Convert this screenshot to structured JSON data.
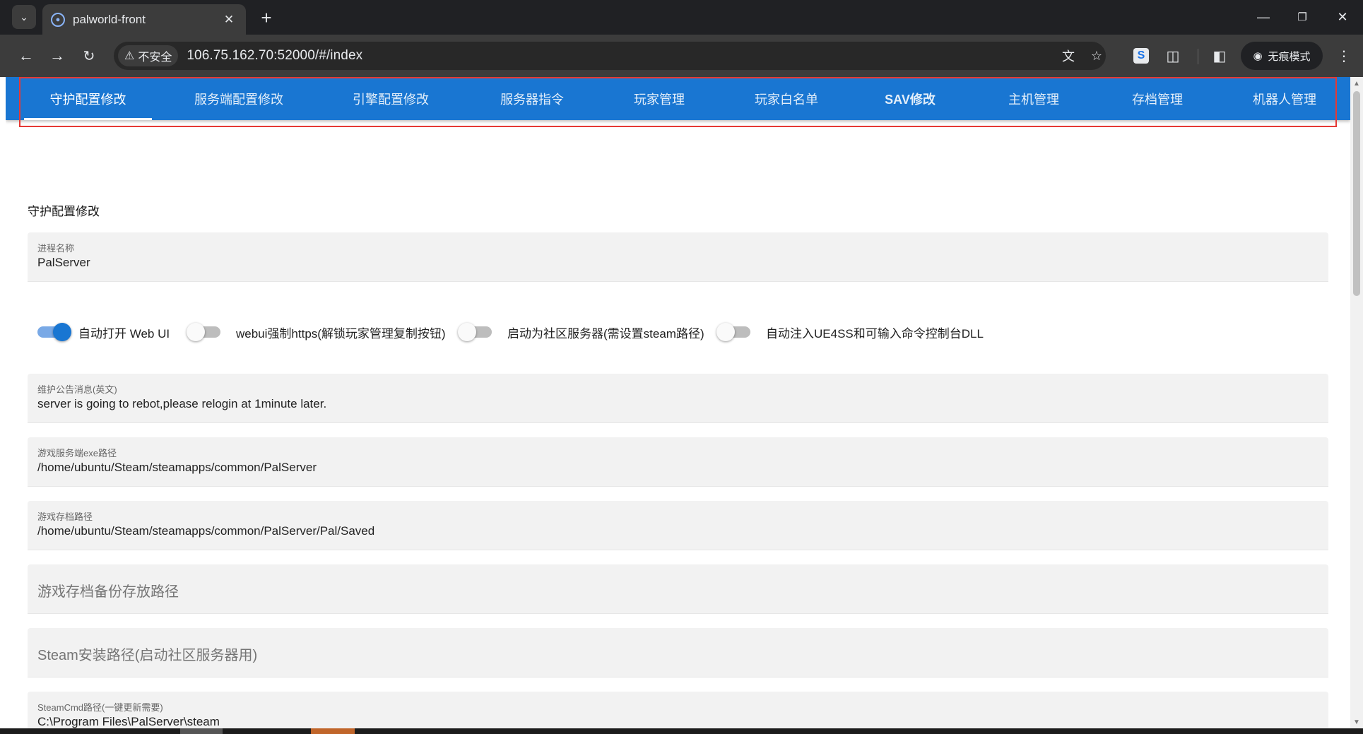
{
  "browser": {
    "tab_title": "palworld-front",
    "security_label": "不安全",
    "url": "106.75.162.70:52000/#/index",
    "incognito_label": "无痕模式"
  },
  "nav": {
    "tabs": [
      {
        "label": "守护配置修改",
        "active": true
      },
      {
        "label": "服务端配置修改"
      },
      {
        "label": "引擎配置修改"
      },
      {
        "label": "服务器指令"
      },
      {
        "label": "玩家管理"
      },
      {
        "label": "玩家白名单"
      },
      {
        "label": "SAV修改"
      },
      {
        "label": "主机管理"
      },
      {
        "label": "存档管理"
      },
      {
        "label": "机器人管理"
      }
    ]
  },
  "form": {
    "section_title": "守护配置修改",
    "process_name": {
      "label": "进程名称",
      "value": "PalServer"
    },
    "switches": [
      {
        "label": "自动打开 Web UI",
        "on": true
      },
      {
        "label": "webui强制https(解锁玩家管理复制按钮)",
        "on": false
      },
      {
        "label": "启动为社区服务器(需设置steam路径)",
        "on": false
      },
      {
        "label": "自动注入UE4SS和可输入命令控制台DLL",
        "on": false
      }
    ],
    "maintenance_message": {
      "label": "维护公告消息(英文)",
      "value": "server is going to rebot,please relogin at 1minute later."
    },
    "exe_path": {
      "label": "游戏服务端exe路径",
      "value": "/home/ubuntu/Steam/steamapps/common/PalServer"
    },
    "save_path": {
      "label": "游戏存档路径",
      "value": "/home/ubuntu/Steam/steamapps/common/PalServer/Pal/Saved"
    },
    "backup_path": {
      "placeholder": "游戏存档备份存放路径"
    },
    "steam_path": {
      "placeholder": "Steam安装路径(启动社区服务器用)"
    },
    "steamcmd_path": {
      "label": "SteamCmd路径(一键更新需要)",
      "value": "C:\\Program Files\\PalServer\\steam"
    }
  }
}
